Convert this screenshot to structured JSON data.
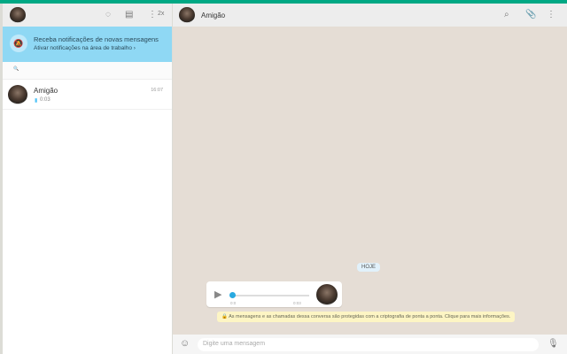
{
  "sidebar": {
    "header": {
      "speed_label": "2x"
    },
    "banner": {
      "title": "Receba notificações de novas mensagens",
      "link": "Ativar notificações na área de trabalho ›"
    },
    "search": {
      "placeholder": "🔍"
    },
    "chats": [
      {
        "name": "Amigão",
        "time": "16:07",
        "preview": "0:03"
      }
    ]
  },
  "conversation": {
    "header": {
      "name": "Amigão"
    },
    "day_label": "HOJE",
    "audio": {
      "elapsed": "0:0",
      "duration": "0:03",
      "progress": 0
    },
    "encryption_notice": "🔒 As mensagens e as chamadas dessa conversa são protegidas com a criptografia de ponta a ponta. Clique para mais informações.",
    "composer": {
      "placeholder": "Digite uma mensagem"
    }
  },
  "colors": {
    "accent": "#00a884",
    "banner": "#8fd8f4",
    "chat_bg": "#e5ddd5"
  }
}
